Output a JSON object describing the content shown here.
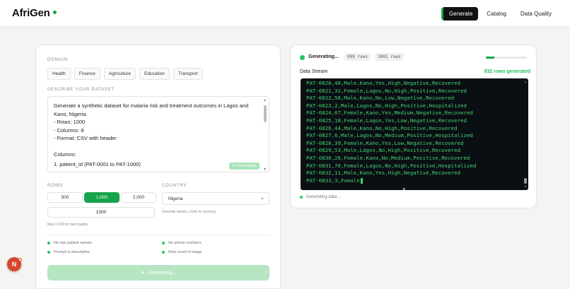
{
  "app": {
    "name": "AfriGen"
  },
  "nav": {
    "items": [
      "Generate",
      "Catalog",
      "Data Quality"
    ],
    "active": "Generate"
  },
  "form": {
    "domain_label": "DOMAIN",
    "domains": [
      "Health",
      "Finance",
      "Agriculture",
      "Education",
      "Transport"
    ],
    "describe_label": "DESCRIBE YOUR DATASET",
    "description_lines": [
      "Generate a synthetic dataset for malaria risk and treatment outcomes in Lagos and",
      "Kano, Nigeria.",
      "- Rows: 1000",
      "- Columns: 8",
      "- Format: CSV with header",
      "",
      "Columns:",
      "1. patient_id (PAT-0001 to PAT-1000)"
    ],
    "textarea_badge": "Generating",
    "rows_label": "ROWS",
    "row_options": [
      "500",
      "1,000",
      "2,000"
    ],
    "row_selected": "1,000",
    "rows_value": "1000",
    "rows_hint": "Max 2,000 for best quality",
    "country_label": "COUNTRY",
    "country_value": "Nigeria",
    "country_hint": "Grounds names, LGAs & currency",
    "checks": [
      "No raw patient names",
      "No phone numbers",
      "Prompt is descriptive",
      "Row count in range"
    ],
    "generate_button": "Generating..."
  },
  "stream": {
    "status": "Generating...",
    "rows_pill_1": "999 rows",
    "rows_pill_2": "1001 rows",
    "progress_fraction": 0.2,
    "label": "Data Stream",
    "count_text": "832 rows generated",
    "lines": [
      "PAT-0820,48,Male,Kano,Yes,High,Negative,Recovered",
      "PAT-0821,31,Female,Lagos,No,High,Positive,Recovered",
      "PAT-0822,56,Male,Kano,No,Low,Negative,Recovered",
      "PAT-0823,2,Male,Lagos,No,High,Positive,Hospitalized",
      "PAT-0824,67,Female,Kano,Yes,Medium,Negative,Recovered",
      "PAT-0825,18,Female,Lagos,Yes,Low,Negative,Recovered",
      "PAT-0826,44,Male,Kano,No,High,Positive,Recovered",
      "PAT-0827,6,Male,Lagos,No,Medium,Positive,Hospitalized",
      "PAT-0828,39,Female,Kano,Yes,Low,Negative,Recovered",
      "PAT-0829,53,Male,Lagos,No,High,Positive,Recovered",
      "PAT-0830,26,Female,Kano,No,Medium,Positive,Recovered",
      "PAT-0831,70,Female,Lagos,No,High,Positive,Hospitalized",
      "PAT-0832,11,Male,Kano,Yes,High,Negative,Recovered",
      "PAT-0833,3,Female"
    ],
    "footer": "Generating data..."
  },
  "avatar": {
    "initial": "N"
  },
  "colors": {
    "accent": "#16a34a",
    "terminal_bg": "#0a0f14",
    "terminal_text": "#46d36b",
    "avatar": "#d9452f"
  }
}
